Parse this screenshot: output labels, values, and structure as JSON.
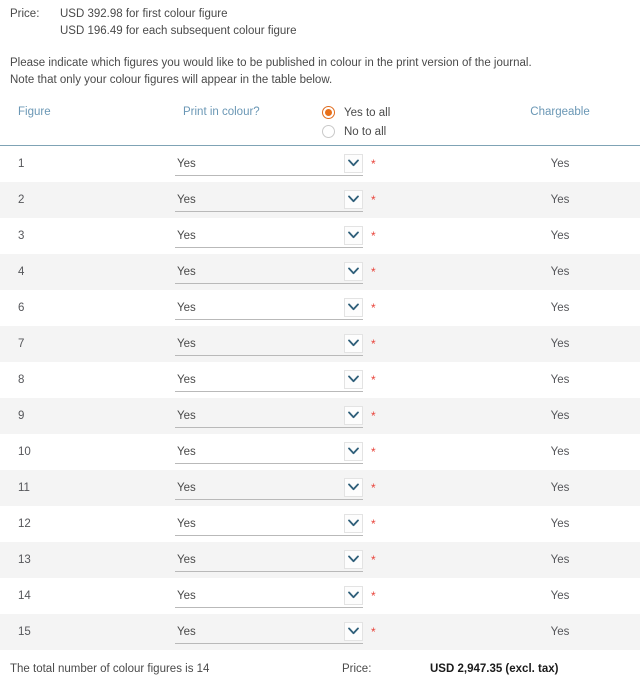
{
  "price_block": {
    "label": "Price:",
    "lines": [
      "USD 392.98 for first colour figure",
      "USD 196.49 for each subsequent colour figure"
    ]
  },
  "instructions": [
    "Please indicate which figures you would like to be published in colour in the print version of the journal.",
    "Note that only your colour figures will appear in the table below."
  ],
  "table": {
    "headers": {
      "figure": "Figure",
      "print_in_colour": "Print in colour?",
      "chargeable": "Chargeable"
    },
    "all_toggle": {
      "yes_label": "Yes to all",
      "no_label": "No to all",
      "selected": "yes"
    },
    "rows": [
      {
        "figure": "1",
        "print": "Yes",
        "chargeable": "Yes",
        "required": "*"
      },
      {
        "figure": "2",
        "print": "Yes",
        "chargeable": "Yes",
        "required": "*"
      },
      {
        "figure": "3",
        "print": "Yes",
        "chargeable": "Yes",
        "required": "*"
      },
      {
        "figure": "4",
        "print": "Yes",
        "chargeable": "Yes",
        "required": "*"
      },
      {
        "figure": "6",
        "print": "Yes",
        "chargeable": "Yes",
        "required": "*"
      },
      {
        "figure": "7",
        "print": "Yes",
        "chargeable": "Yes",
        "required": "*"
      },
      {
        "figure": "8",
        "print": "Yes",
        "chargeable": "Yes",
        "required": "*"
      },
      {
        "figure": "9",
        "print": "Yes",
        "chargeable": "Yes",
        "required": "*"
      },
      {
        "figure": "10",
        "print": "Yes",
        "chargeable": "Yes",
        "required": "*"
      },
      {
        "figure": "11",
        "print": "Yes",
        "chargeable": "Yes",
        "required": "*"
      },
      {
        "figure": "12",
        "print": "Yes",
        "chargeable": "Yes",
        "required": "*"
      },
      {
        "figure": "13",
        "print": "Yes",
        "chargeable": "Yes",
        "required": "*"
      },
      {
        "figure": "14",
        "print": "Yes",
        "chargeable": "Yes",
        "required": "*"
      },
      {
        "figure": "15",
        "print": "Yes",
        "chargeable": "Yes",
        "required": "*"
      }
    ]
  },
  "footer": {
    "total_text": "The total number of colour figures is 14",
    "price_label": "Price:",
    "price_value": "USD 2,947.35 (excl. tax)"
  },
  "colors": {
    "header_text": "#6a97b5",
    "rule": "#7fa3b5",
    "radio_accent": "#e8701a",
    "required_star": "#e8453c",
    "row_alt_bg": "#f4f4f4",
    "chevron": "#2f5f7a"
  },
  "icons": {
    "chevron_down": "chevron-down-icon",
    "radio_selected": "radio-selected-icon",
    "radio_unselected": "radio-unselected-icon"
  }
}
